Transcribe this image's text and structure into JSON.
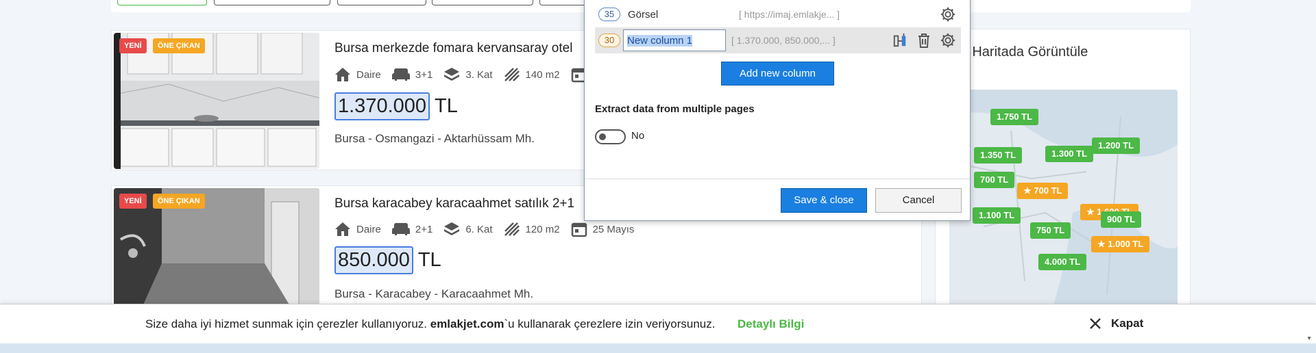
{
  "listings": [
    {
      "badge_new": "YENİ",
      "badge_featured": "ÖNE ÇIKAN",
      "title": "Bursa merkezde fomara kervansaray otel",
      "type": "Daire",
      "rooms": "3+1",
      "floor": "3. Kat",
      "area": "140 m2",
      "date": "",
      "price": "1.370.000",
      "currency": "TL",
      "location": "Bursa - Osmangazi - Aktarhüssam Mh."
    },
    {
      "badge_new": "YENİ",
      "badge_featured": "ÖNE ÇIKAN",
      "title": "Bursa karacabey karacaahmet satılık 2+1",
      "type": "Daire",
      "rooms": "2+1",
      "floor": "6. Kat",
      "area": "120 m2",
      "date": "25 Mayıs",
      "price": "850.000",
      "currency": "TL",
      "location": "Bursa - Karacabey - Karacaahmet Mh."
    }
  ],
  "map": {
    "title": "ları Haritada Görüntüle",
    "pins": [
      "1.750 TL",
      "1.350 TL",
      "1.300 TL",
      "1.200 TL",
      "700 TL",
      "700 TL",
      "1.600 TL",
      "1.100 TL",
      "900 TL",
      "750 TL",
      "1.000 TL",
      "4.000 TL"
    ]
  },
  "dialog": {
    "rows": [
      {
        "number": "35",
        "name": "Görsel",
        "sample": "[ https://imaj.emlakje... ]"
      },
      {
        "number": "30",
        "name": "New column 1",
        "sample": "[ 1.370.000, 850.000,... ]"
      }
    ],
    "add_column": "Add new column",
    "extract_label": "Extract data from multiple pages",
    "toggle_label": "No",
    "save": "Save & close",
    "cancel": "Cancel"
  },
  "cookie": {
    "text_before": "Size daha iyi hizmet sunmak için çerezler kullanıyoruz. ",
    "site": "emlakjet.com",
    "text_after": "`u kullanarak çerezlere izin veriyorsunuz.",
    "link": "Detaylı Bilgi",
    "close": "Kapat"
  },
  "colors": {
    "accent_blue": "#1a7fe0",
    "green": "#4cb846",
    "orange": "#f5a623",
    "red": "#e84a4a"
  }
}
